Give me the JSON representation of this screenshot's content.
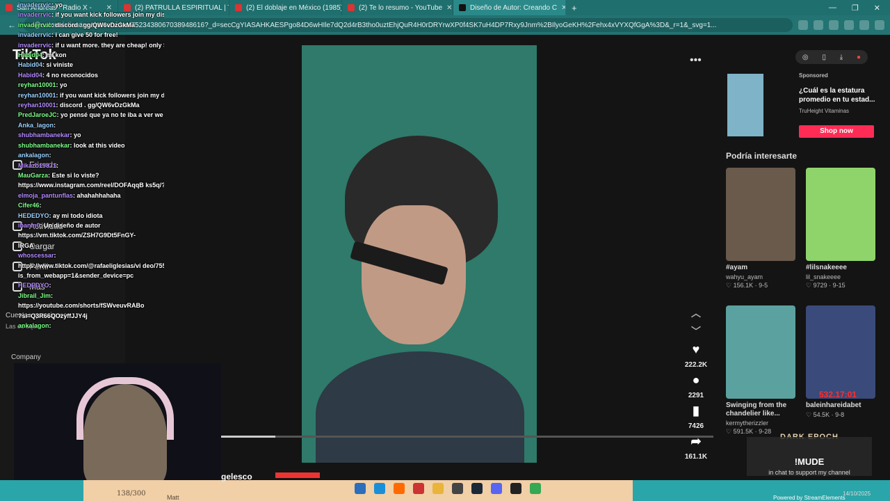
{
  "tabs": [
    {
      "label": "San Andreas - Radio X -",
      "active": false
    },
    {
      "label": "(2) PATRULLA ESPIRITUAL | TA",
      "active": false
    },
    {
      "label": "(2) El doblaje en México (1985)",
      "active": false
    },
    {
      "label": "(2) Te lo resumo - YouTube",
      "active": false
    },
    {
      "label": "Diseño de Autor: Creando C",
      "active": true
    }
  ],
  "address": {
    "url": "/@autorcristianangelesco/video/7523438067038948616?_d=secCgYIASAHKAESPgo84D6wHIle7dQ2d4rB3tho0uztEhjQuR4H0rDRYrwXP0f4SK7uH4DP7Rxy9Jnm%2BIlyoGeKH%2Fehx4xVYXQfGgA%3D&_r=1&_svg=1..."
  },
  "sidebar": {
    "logo": "TikTok",
    "friends": "Friends",
    "activity": "Actividad",
    "upload": "Cargar",
    "profile": "Perfil",
    "more": "Más",
    "following_title": "Cuentas que sigues",
    "following_sub": "Las cu aquí",
    "company": "Company"
  },
  "chat": [
    {
      "user": "invaderrvic",
      "msg": "yo"
    },
    {
      "user": "invaderrvic",
      "msg": "if you want kick followers join my discord"
    },
    {
      "user": "invaderrvic",
      "msg": "discord . gg/QW6vDzGkMa"
    },
    {
      "user": "invaderrvic",
      "msg": "i can give 50 for free!"
    },
    {
      "user": "invaderrvic",
      "msg": "if u want more. they are cheap! only $5 for each 1000 followers"
    },
    {
      "user": "Habid04",
      "msg": "mi kon"
    },
    {
      "user": "Habid04",
      "msg": "si viniste"
    },
    {
      "user": "Habid04",
      "msg": "4 no reconocidos"
    },
    {
      "user": "reyhan10001",
      "msg": "yo"
    },
    {
      "user": "reyhan10001",
      "msg": "if you want kick followers join my discord"
    },
    {
      "user": "reyhan10001",
      "msg": "discord . gg/QW6vDzGkMa"
    },
    {
      "user": "PredJaroeJC",
      "msg": "yo pensé que ya no te iba a ver we"
    },
    {
      "user": "Anka_lagon",
      "msg": ""
    },
    {
      "user": "shubhambanekar",
      "msg": "yo"
    },
    {
      "user": "shubhambanekar",
      "msg": "look at this video"
    },
    {
      "user": "ankalagon",
      "msg": ""
    },
    {
      "user": "Mikazo19871",
      "msg": ""
    },
    {
      "user": "MauGarza",
      "msg": "Este si lo viste?"
    },
    {
      "user": "",
      "msg": "https://www.instagram.com/reel/DOFAqqB ks5q/?igsh=MXN5OWZnbjcyY2U5"
    },
    {
      "user": "elmoja_pantunflas",
      "msg": "ahahahhahaha"
    },
    {
      "user": "Cifer46",
      "msg": ""
    },
    {
      "user": "HEDEDYO",
      "msg": "ay mi todo idiota"
    },
    {
      "user": "ibanm0",
      "msg": "Un diseño de autor"
    },
    {
      "user": "",
      "msg": "https://vm.tiktok.com/ZSH7G9Dt5FnGY-"
    },
    {
      "user": "",
      "msg": "IRGA-"
    },
    {
      "user": "whoscessar",
      "msg": ""
    },
    {
      "user": "",
      "msg": "https://www.tiktok.com/@rafaeliglesias/vi deo/7558730021628677384?"
    },
    {
      "user": "",
      "msg": "is_from_webapp=1&sender_device=pc"
    },
    {
      "user": "HEDEDYO",
      "msg": ""
    },
    {
      "user": "Jibrail_Jim",
      "msg": ""
    },
    {
      "user": "",
      "msg": "https://youtube.com/shorts/fSWveuvRABo"
    },
    {
      "user": "",
      "msg": "?si=Q3R66QOzyffJJY4j"
    },
    {
      "user": "ankalagon",
      "msg": ""
    }
  ],
  "video": {
    "likes": "222.2K",
    "comments": "2291",
    "saves": "7426",
    "shares": "161.1K",
    "progress": 0.11,
    "author_fragment": "gelesco"
  },
  "ad": {
    "sponsored": "Sponsored",
    "title": "¿Cuál es la estatura promedio en tu estad...",
    "brand": "TruHeight Vitaminas",
    "cta": "Shop now"
  },
  "suggestions": {
    "title": "Podría interesarte",
    "items": [
      {
        "caption": "#ayam",
        "author": "wahyu_ayam",
        "likes": "156.1K",
        "date": "9-5",
        "color": "#6a5a4c"
      },
      {
        "caption": "#lilsnakeeee",
        "author": "lil_snakeeee",
        "likes": "9729",
        "date": "9-15",
        "color": "#8fd46b"
      },
      {
        "caption": "Swinging from the chandelier like...",
        "author": "kermytherizzler",
        "likes": "591.5K",
        "date": "9-28",
        "color": "#5aa1a0"
      },
      {
        "caption": "baleinhareidabet",
        "author": "",
        "likes": "54.5K",
        "date": "9-8",
        "color": "#3a4a7a"
      }
    ]
  },
  "overlay": {
    "game": "DARK EPOCH",
    "timer": "532.17:01",
    "mude_title": "!MUDE",
    "mude_sub": "in chat to support my channel",
    "counter": "138/300",
    "matt": "Matt",
    "powered": "Powered by StreamElements",
    "date": "14/10/2025"
  }
}
